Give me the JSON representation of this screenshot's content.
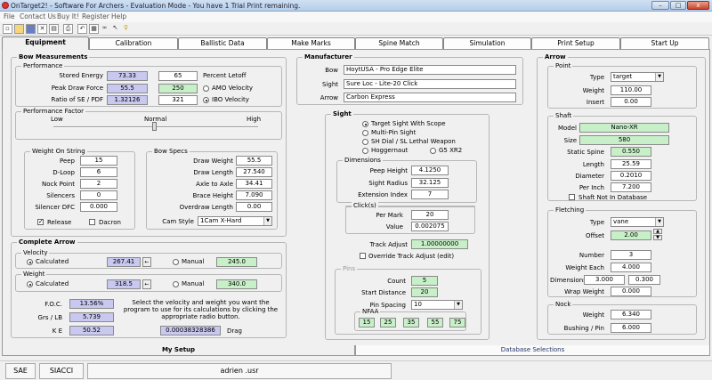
{
  "window": {
    "title": "OnTarget2! - Software For Archers - Evaluation Mode - You have 1 Trial Print remaining.",
    "minimize": "–",
    "maximize": "□",
    "close": "x"
  },
  "menu": [
    "File",
    "Contact Us",
    "Buy It!",
    "Register",
    "Help"
  ],
  "tabs": [
    "Equipment",
    "Calibration",
    "Ballistic Data",
    "Make Marks",
    "Spine Match",
    "Simulation",
    "Print Setup",
    "Start Up"
  ],
  "bow_measurements": {
    "title": "Bow Measurements",
    "performance": {
      "title": "Performance",
      "stored_energy_label": "Stored Energy",
      "stored_energy": "73.33",
      "peak_draw_label": "Peak Draw Force",
      "peak_draw": "55.5",
      "ratio_label": "Ratio of SE / PDF",
      "ratio": "1.32126",
      "letoff": "65",
      "letoff_label": "Percent Letoff",
      "amo_value": "250",
      "amo_label": "AMO Velocity",
      "ibo_value": "321",
      "ibo_label": "IBO Velocity"
    },
    "perf_factor": {
      "title": "Performance Factor",
      "low": "Low",
      "normal": "Normal",
      "high": "High"
    },
    "weight_on_string": {
      "title": "Weight On String",
      "rows": [
        {
          "label": "Peep",
          "value": "15"
        },
        {
          "label": "D-Loop",
          "value": "6"
        },
        {
          "label": "Nock Point",
          "value": "2"
        },
        {
          "label": "Silencers",
          "value": "0"
        },
        {
          "label": "Silencer DFC",
          "value": "0.000"
        }
      ],
      "release": "Release",
      "dacron": "Dacron"
    },
    "bow_specs": {
      "title": "Bow Specs",
      "rows": [
        {
          "label": "Draw Weight",
          "value": "55.5"
        },
        {
          "label": "Draw Length",
          "value": "27.540"
        },
        {
          "label": "Axle to Axle",
          "value": "34.41"
        },
        {
          "label": "Brace Height",
          "value": "7.090"
        },
        {
          "label": "Overdraw Length",
          "value": "0.00"
        }
      ],
      "cam_label": "Cam Style",
      "cam_value": "1Cam X-Hard"
    }
  },
  "complete_arrow": {
    "title": "Complete Arrow",
    "velocity_title": "Velocity",
    "calculated": "Calculated",
    "manual": "Manual",
    "vel_calc": "267.41",
    "vel_manual": "245.0",
    "weight_title": "Weight",
    "wt_calc": "318.5",
    "wt_manual": "340.0",
    "foc_label": "F.O.C.",
    "foc": "13.56%",
    "grs_label": "Grs / LB",
    "grs": "5.739",
    "ke_label": "K E",
    "ke": "50.52",
    "drag": "0.00038328386",
    "drag_label": "Drag",
    "note": "Select the velocity and weight you want the program to use for its calculations by clicking the appropriate radio button."
  },
  "manufacturer": {
    "title": "Manufacturer",
    "bow_label": "Bow",
    "bow": "HoytUSA - Pro Edge Elite",
    "sight_label": "Sight",
    "sight": "Sure Loc - Lite-20 Click",
    "arrow_label": "Arrow",
    "arrow": "Carbon Express"
  },
  "sight": {
    "title": "Sight",
    "options": [
      "Target Sight With Scope",
      "Multi-Pin Sight",
      "SH Dial / SL Lethal Weapon",
      "Hoggernaut",
      "G5 XR2"
    ],
    "dimensions": {
      "title": "Dimensions",
      "peep_height_label": "Peep Height",
      "peep_height": "4.1250",
      "sight_radius_label": "Sight Radius",
      "sight_radius": "32.125",
      "ext_index_label": "Extension Index",
      "ext_index": "7"
    },
    "clicks": {
      "title": "Click(s)",
      "per_mark_label": "Per Mark",
      "per_mark": "20",
      "value_label": "Value",
      "value": "0.002075"
    },
    "track_adjust_label": "Track Adjust",
    "track_adjust": "1.00000000",
    "override": "Override Track Adjust (edit)",
    "pins": {
      "title": "Pins",
      "count_label": "Count",
      "count": "5",
      "start_label": "Start Distance",
      "start": "20",
      "spacing_label": "Pin Spacing",
      "spacing": "10",
      "nfaa_title": "NFAA",
      "nfaa": [
        "15",
        "25",
        "35",
        "55",
        "75"
      ]
    }
  },
  "arrow": {
    "title": "Arrow",
    "point": {
      "title": "Point",
      "type_label": "Type",
      "type": "target",
      "weight_label": "Weight",
      "weight": "110.00",
      "insert_label": "Insert",
      "insert": "0.00"
    },
    "shaft": {
      "title": "Shaft",
      "model_label": "Model",
      "model": "Nano-XR",
      "size_label": "Size",
      "size": "580",
      "static_label": "Static Spine",
      "static": "0.550",
      "length_label": "Length",
      "length": "25.59",
      "diameter_label": "Diameter",
      "diameter": "0.2010",
      "perinch_label": "Per Inch",
      "perinch": "7.200",
      "notindb": "Shaft Not In Database"
    },
    "fletching": {
      "title": "Fletching",
      "type_label": "Type",
      "type": "vane",
      "offset_label": "Offset",
      "offset": "2.00",
      "number_label": "Number",
      "number": "3",
      "weight_label": "Weight Each",
      "weight": "4.000",
      "dim_label": "Dimensions",
      "dim1": "3.000",
      "dim2": "0.300",
      "wrap_label": "Wrap Weight",
      "wrap": "0.000"
    },
    "nock": {
      "title": "Nock",
      "weight_label": "Weight",
      "weight": "6.340",
      "bushing_label": "Bushing / Pin",
      "bushing": "6.000"
    }
  },
  "bottom_tabs": [
    "My Setup",
    "Database Selections"
  ],
  "status": {
    "sae": "SAE",
    "siacci": "SIACCI",
    "file": "adrien .usr"
  }
}
